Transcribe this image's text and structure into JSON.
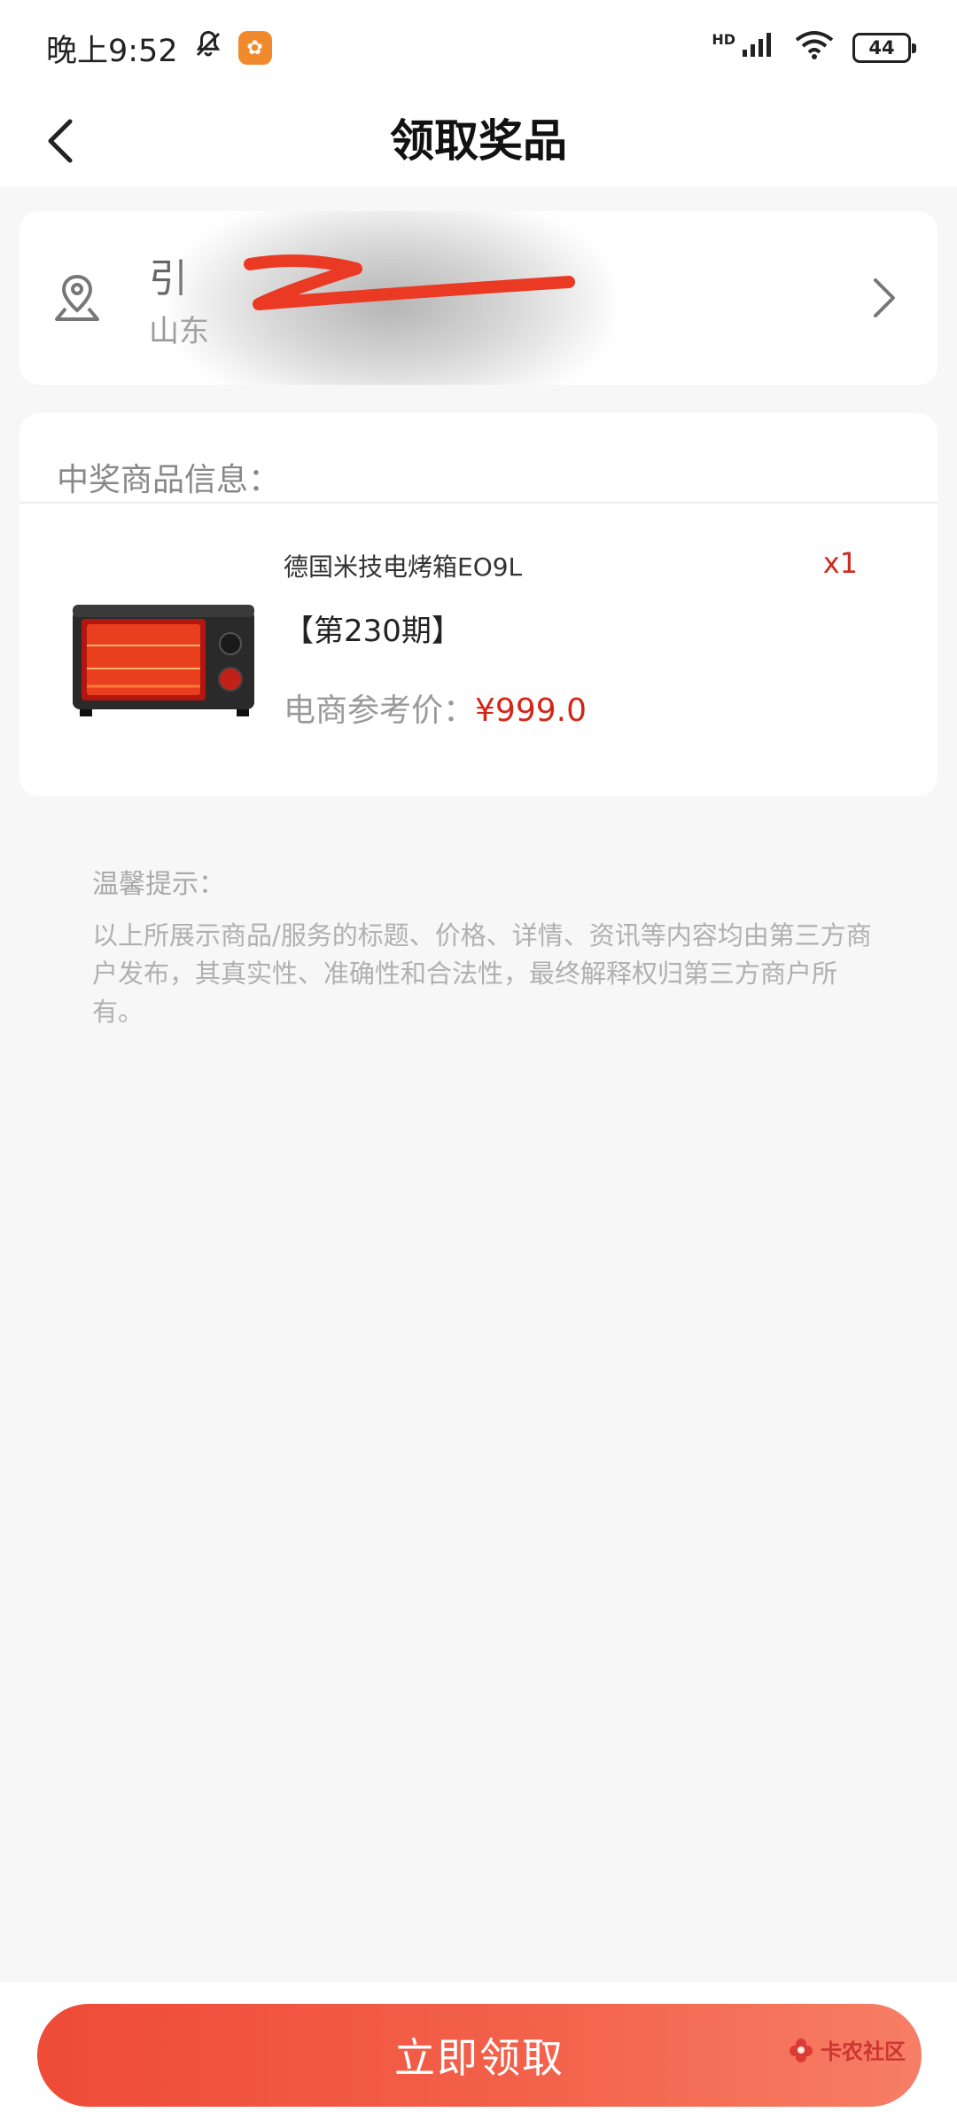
{
  "status_bar": {
    "time": "晚上9:52",
    "network_label": "HD",
    "battery": "44"
  },
  "nav": {
    "title": "领取奖品"
  },
  "address": {
    "name_partial": "引",
    "detail_partial": "山东"
  },
  "prize": {
    "header": "中奖商品信息：",
    "product_name": "德国米技电烤箱EO9L",
    "quantity": "x1",
    "period": "【第230期】",
    "price_label": "电商参考价：",
    "price_value": "¥999.0"
  },
  "notice": {
    "title": "温馨提示：",
    "text": "以上所展示商品/服务的标题、价格、详情、资讯等内容均由第三方商户发布，其真实性、准确性和合法性，最终解释权归第三方商户所有。"
  },
  "bottom": {
    "claim_label": "立即领取",
    "watermark": "卡农社区"
  },
  "colors": {
    "accent_red": "#d32619",
    "button_start": "#ee4b38",
    "button_end": "#f77e66"
  }
}
